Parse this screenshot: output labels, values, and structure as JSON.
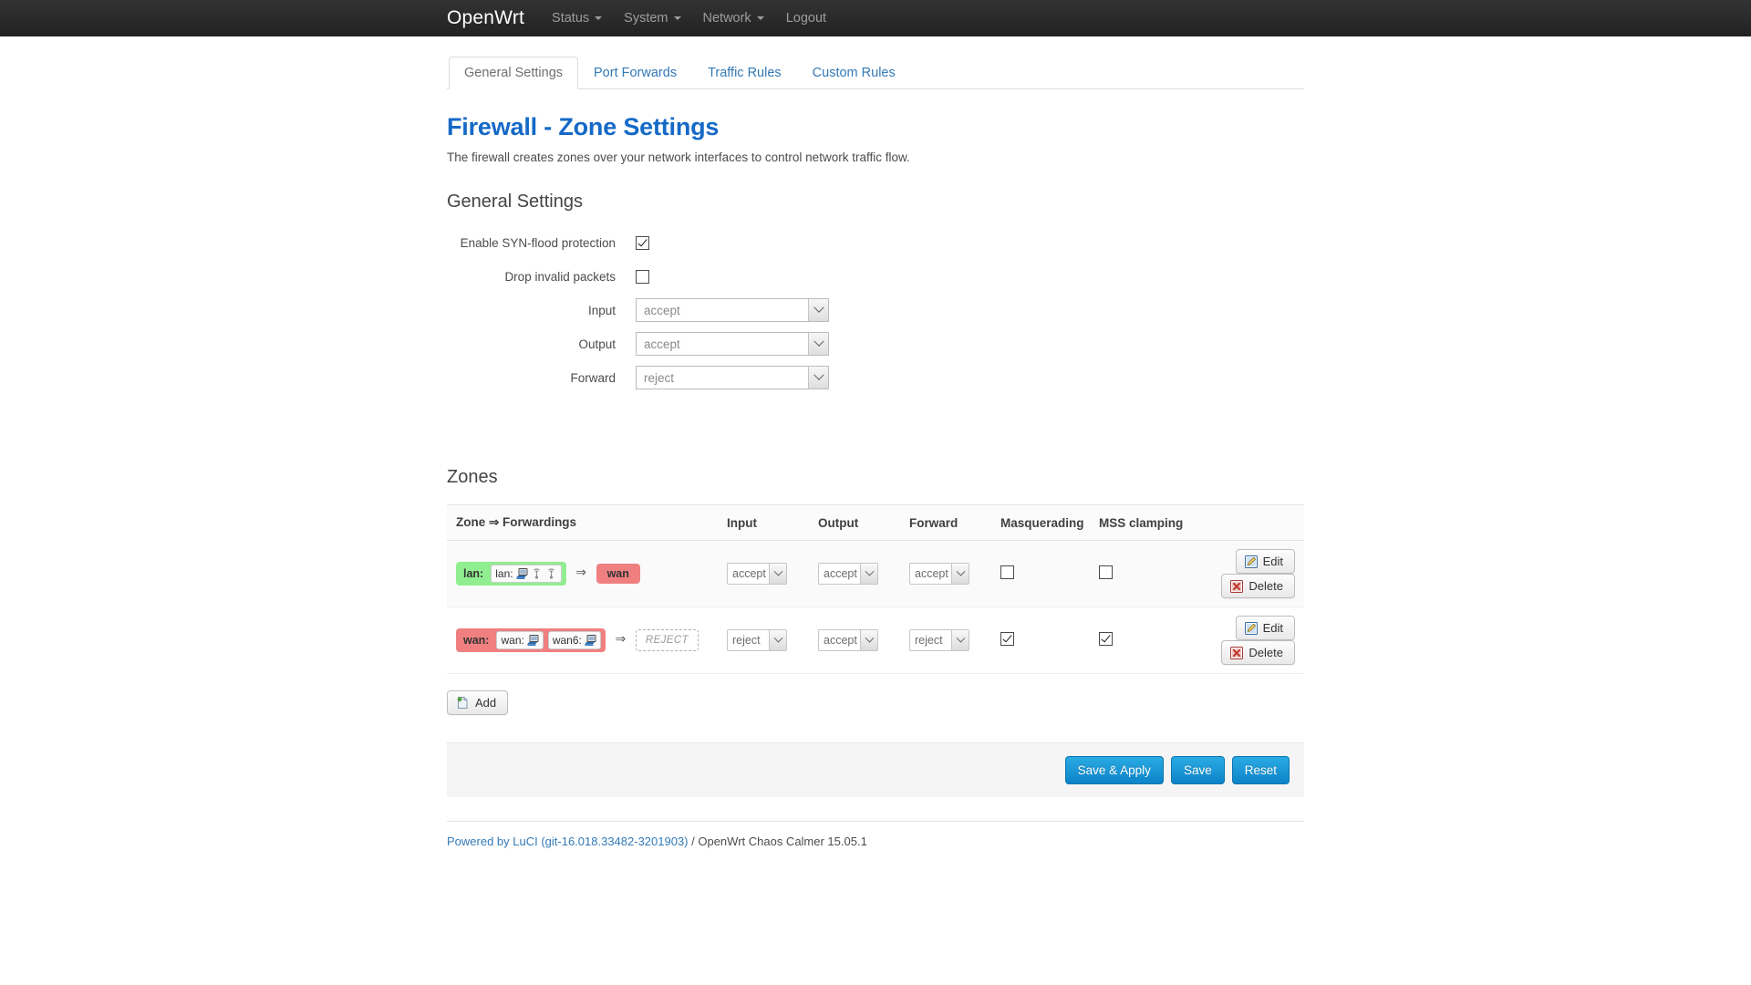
{
  "navbar": {
    "brand": "OpenWrt",
    "items": [
      {
        "label": "Status",
        "has_caret": true
      },
      {
        "label": "System",
        "has_caret": true
      },
      {
        "label": "Network",
        "has_caret": true
      },
      {
        "label": "Logout",
        "has_caret": false
      }
    ]
  },
  "tabs": [
    {
      "label": "General Settings",
      "active": true
    },
    {
      "label": "Port Forwards",
      "active": false
    },
    {
      "label": "Traffic Rules",
      "active": false
    },
    {
      "label": "Custom Rules",
      "active": false
    }
  ],
  "page": {
    "title": "Firewall - Zone Settings",
    "description": "The firewall creates zones over your network interfaces to control network traffic flow.",
    "title_color": "#1569c7"
  },
  "general_settings": {
    "heading": "General Settings",
    "fields": [
      {
        "label": "Enable SYN-flood protection",
        "type": "checkbox",
        "checked": true
      },
      {
        "label": "Drop invalid packets",
        "type": "checkbox",
        "checked": false
      },
      {
        "label": "Input",
        "type": "select",
        "value": "accept"
      },
      {
        "label": "Output",
        "type": "select",
        "value": "accept"
      },
      {
        "label": "Forward",
        "type": "select",
        "value": "reject"
      }
    ]
  },
  "zones": {
    "heading": "Zones",
    "columns": [
      "Zone ⇒ Forwardings",
      "Input",
      "Output",
      "Forward",
      "Masquerading",
      "MSS clamping",
      ""
    ],
    "forward_arrow": "⇒",
    "rows": [
      {
        "zone_name": "lan:",
        "zone_color": "green",
        "interfaces": [
          {
            "label": "lan:",
            "icons": [
              "ethernet-icon",
              "wifi-icon",
              "wifi-icon"
            ]
          }
        ],
        "destinations": [
          {
            "label": "wan",
            "color": "red",
            "type": "zone"
          }
        ],
        "input": "accept",
        "output": "accept",
        "forward": "accept",
        "masquerading": false,
        "mss_clamping": false,
        "edit_label": "Edit",
        "delete_label": "Delete"
      },
      {
        "zone_name": "wan:",
        "zone_color": "red",
        "interfaces": [
          {
            "label": "wan:",
            "icons": [
              "ethernet-icon"
            ]
          },
          {
            "label": "wan6:",
            "icons": [
              "ethernet-icon"
            ]
          }
        ],
        "destinations": [
          {
            "label": "REJECT",
            "color": "none",
            "type": "policy"
          }
        ],
        "input": "reject",
        "output": "accept",
        "forward": "reject",
        "masquerading": true,
        "mss_clamping": true,
        "edit_label": "Edit",
        "delete_label": "Delete"
      }
    ],
    "add_label": "Add"
  },
  "actions": {
    "save_apply": "Save & Apply",
    "save": "Save",
    "reset": "Reset"
  },
  "footer": {
    "link_text": "Powered by LuCI (git-16.018.33482-3201903)",
    "suffix": " / OpenWrt Chaos Calmer 15.05.1"
  },
  "colors": {
    "accent_blue": "#337ab7",
    "title_blue": "#1569c7",
    "zone_green": "#90ee90",
    "zone_red": "#f08080",
    "navbar_bg": "#222222",
    "button_blue": "#0c83c8"
  }
}
